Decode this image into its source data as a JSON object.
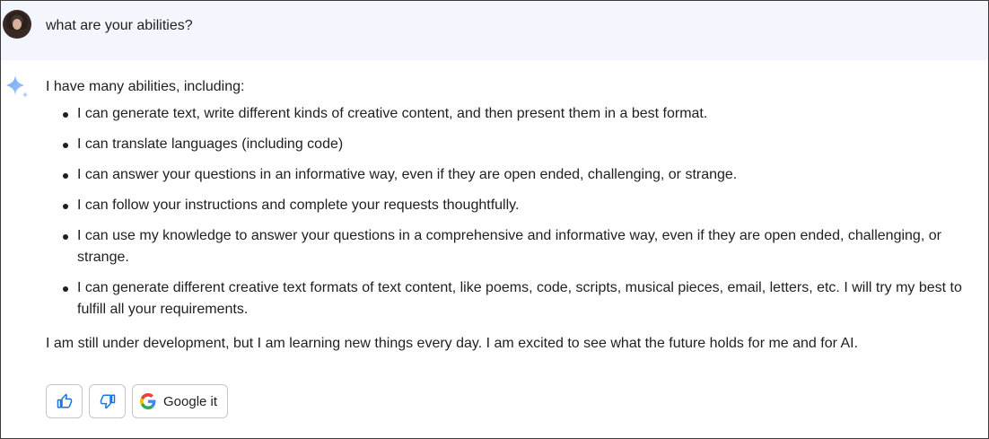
{
  "user": {
    "prompt": "what are your abilities?"
  },
  "response": {
    "intro": "I have many abilities, including:",
    "bullets": [
      "I can generate text, write different kinds of creative content, and then present them in a best format.",
      "I can translate languages (including code)",
      "I can answer your questions in an informative way, even if they are open ended, challenging, or strange.",
      "I can follow your instructions and complete your requests thoughtfully.",
      "I can use my knowledge to answer your questions in a comprehensive and informative way, even if they are open ended, challenging, or strange.",
      "I can generate different creative text formats of text content, like poems, code, scripts, musical pieces, email, letters, etc. I will try my best to fulfill all your requirements."
    ],
    "outro": "I am still under development, but I am learning new things every day. I am excited to see what the future holds for me and for AI."
  },
  "actions": {
    "thumbs_up_icon": "thumbs-up-icon",
    "thumbs_down_icon": "thumbs-down-icon",
    "google_label": "Google it"
  },
  "colors": {
    "user_bg": "#f3f6fc",
    "accent_blue": "#1a73e8",
    "border": "#c4c7c5"
  }
}
